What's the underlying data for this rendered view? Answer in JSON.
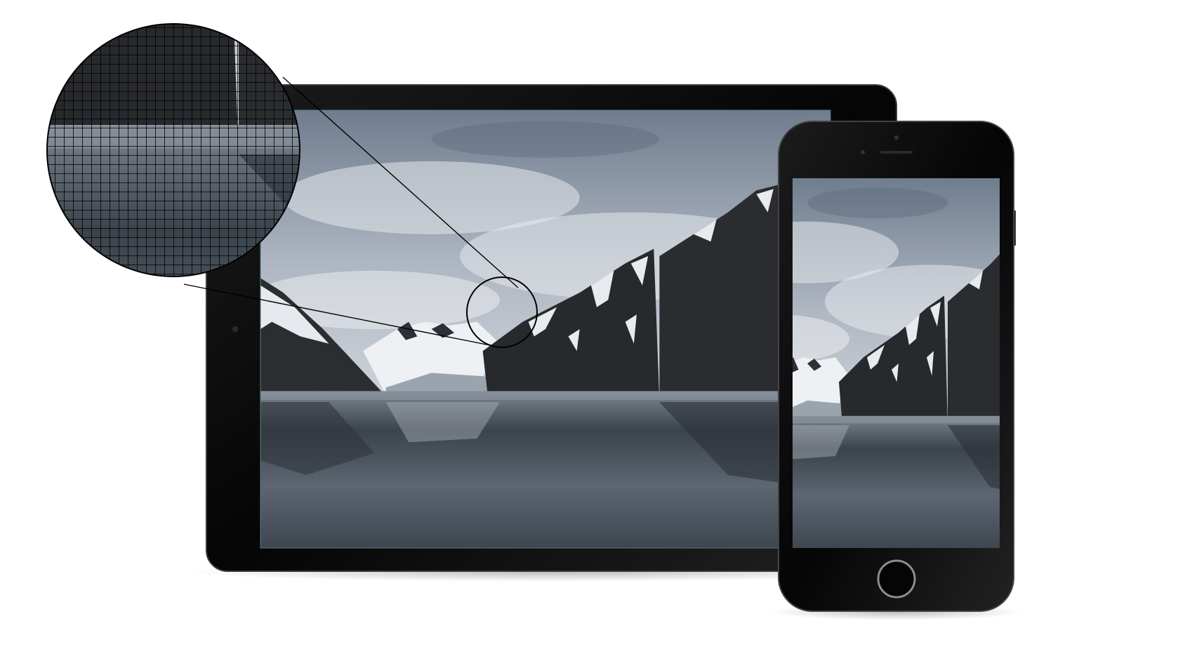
{
  "scene": {
    "devices": [
      "tablet",
      "phone"
    ],
    "magnifier": {
      "shape": "circle",
      "overlay": "pixel-grid"
    },
    "colors": {
      "background": "#ffffff",
      "device_body": "#0a0a0a",
      "sky_top": "#6c7a8c",
      "sky_bottom": "#c9ced6",
      "mountain": "#2a2c30",
      "snow": "#e8ebef",
      "water": "#4a5560"
    }
  },
  "icons": {
    "home_button": "home-button-icon",
    "camera": "camera-icon",
    "speaker": "speaker-icon"
  }
}
